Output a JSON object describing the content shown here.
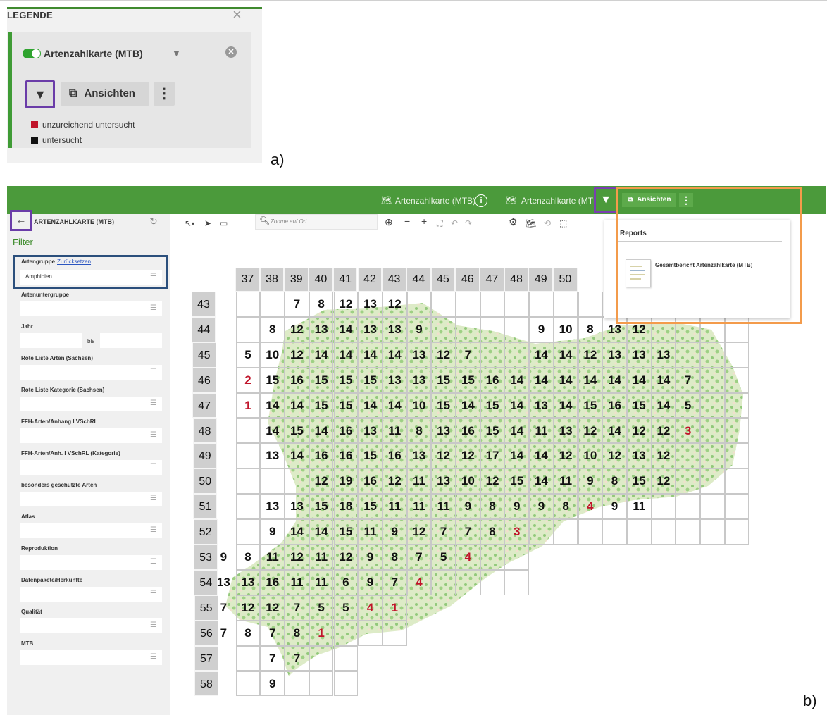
{
  "panel_a": {
    "legend_title": "LEGENDE",
    "close_glyph": "×",
    "layer_name": "Artenzahlkarte (MTB)",
    "filter_button_glyph": "▼",
    "ansichten_label": "Ansichten",
    "more_glyph": "⋮",
    "legend_items": [
      {
        "label": "unzureichend untersucht",
        "color": "#c0142a"
      },
      {
        "label": "untersucht",
        "color": "#111111"
      }
    ],
    "panel_label": "a)"
  },
  "topbar": {
    "layer_title_1": "Artenzahlkarte (MTB)",
    "layer_title_2": "Artenzahlkarte (MTE",
    "info_glyph": "i",
    "ansichten_label": "Ansichten",
    "more_glyph": "⋮"
  },
  "sidebar": {
    "title": "ARTENZAHLKARTE (MTB)",
    "filter_heading": "Filter",
    "artengruppe": {
      "label": "Artengruppe",
      "reset_link": "Zurücksetzen",
      "value": "Amphibien"
    },
    "fields": [
      {
        "label": "Artenuntergruppe"
      },
      {
        "label": "Jahr",
        "between": "bis"
      },
      {
        "label": "Rote Liste Arten (Sachsen)"
      },
      {
        "label": "Rote Liste Kategorie (Sachsen)"
      },
      {
        "label": "FFH-Arten/Anhang I VSchRL"
      },
      {
        "label": "FFH-Arten/Anh. I VSchRL (Kategorie)"
      },
      {
        "label": "besonders geschützte Arten"
      },
      {
        "label": "Atlas"
      },
      {
        "label": "Reproduktion"
      },
      {
        "label": "Datenpakete/Herkünfte"
      },
      {
        "label": "Qualität"
      },
      {
        "label": "MTB"
      }
    ]
  },
  "map_toolbar": {
    "search_placeholder": "Zoome auf Ort ..."
  },
  "reports": {
    "title": "Reports",
    "item": "Gesamtbericht Artenzahlkarte (MTB)"
  },
  "map": {
    "column_headers": [
      "37",
      "38",
      "39",
      "40",
      "41",
      "42",
      "43",
      "44",
      "45",
      "46",
      "47",
      "48",
      "49",
      "50"
    ],
    "row_headers": [
      "43",
      "44",
      "45",
      "46",
      "47",
      "48",
      "49",
      "50",
      "51",
      "52",
      "53",
      "54",
      "55",
      "56",
      "57",
      "58"
    ],
    "red_color": "#c0142a",
    "black_color": "#111111",
    "counts": [
      {
        "row": 0,
        "col": 3,
        "v": "7"
      },
      {
        "row": 0,
        "col": 4,
        "v": "8"
      },
      {
        "row": 0,
        "col": 5,
        "v": "12"
      },
      {
        "row": 0,
        "col": 6,
        "v": "13"
      },
      {
        "row": 0,
        "col": 7,
        "v": "12"
      },
      {
        "row": 1,
        "col": 2,
        "v": "8"
      },
      {
        "row": 1,
        "col": 3,
        "v": "12"
      },
      {
        "row": 1,
        "col": 4,
        "v": "13"
      },
      {
        "row": 1,
        "col": 5,
        "v": "14"
      },
      {
        "row": 1,
        "col": 6,
        "v": "13"
      },
      {
        "row": 1,
        "col": 7,
        "v": "13"
      },
      {
        "row": 1,
        "col": 8,
        "v": "9"
      },
      {
        "row": 1,
        "col": 13,
        "v": "9"
      },
      {
        "row": 1,
        "col": 14,
        "v": "10"
      },
      {
        "row": 1,
        "col": 15,
        "v": "8"
      },
      {
        "row": 1,
        "col": 16,
        "v": "13"
      },
      {
        "row": 1,
        "col": 17,
        "v": "12"
      },
      {
        "row": 2,
        "col": 1,
        "v": "5"
      },
      {
        "row": 2,
        "col": 2,
        "v": "10"
      },
      {
        "row": 2,
        "col": 3,
        "v": "12"
      },
      {
        "row": 2,
        "col": 4,
        "v": "14"
      },
      {
        "row": 2,
        "col": 5,
        "v": "14"
      },
      {
        "row": 2,
        "col": 6,
        "v": "14"
      },
      {
        "row": 2,
        "col": 7,
        "v": "14"
      },
      {
        "row": 2,
        "col": 8,
        "v": "13"
      },
      {
        "row": 2,
        "col": 9,
        "v": "12"
      },
      {
        "row": 2,
        "col": 10,
        "v": "7"
      },
      {
        "row": 2,
        "col": 13,
        "v": "14"
      },
      {
        "row": 2,
        "col": 14,
        "v": "14"
      },
      {
        "row": 2,
        "col": 15,
        "v": "12"
      },
      {
        "row": 2,
        "col": 16,
        "v": "13"
      },
      {
        "row": 2,
        "col": 17,
        "v": "13"
      },
      {
        "row": 2,
        "col": 18,
        "v": "13"
      },
      {
        "row": 3,
        "col": 1,
        "v": "2",
        "red": true
      },
      {
        "row": 3,
        "col": 2,
        "v": "15"
      },
      {
        "row": 3,
        "col": 3,
        "v": "16"
      },
      {
        "row": 3,
        "col": 4,
        "v": "15"
      },
      {
        "row": 3,
        "col": 5,
        "v": "15"
      },
      {
        "row": 3,
        "col": 6,
        "v": "15"
      },
      {
        "row": 3,
        "col": 7,
        "v": "13"
      },
      {
        "row": 3,
        "col": 8,
        "v": "13"
      },
      {
        "row": 3,
        "col": 9,
        "v": "15"
      },
      {
        "row": 3,
        "col": 10,
        "v": "15"
      },
      {
        "row": 3,
        "col": 11,
        "v": "16"
      },
      {
        "row": 3,
        "col": 12,
        "v": "14"
      },
      {
        "row": 3,
        "col": 13,
        "v": "14"
      },
      {
        "row": 3,
        "col": 14,
        "v": "14"
      },
      {
        "row": 3,
        "col": 15,
        "v": "14"
      },
      {
        "row": 3,
        "col": 16,
        "v": "14"
      },
      {
        "row": 3,
        "col": 17,
        "v": "14"
      },
      {
        "row": 3,
        "col": 18,
        "v": "14"
      },
      {
        "row": 3,
        "col": 19,
        "v": "7"
      },
      {
        "row": 4,
        "col": 1,
        "v": "1",
        "red": true
      },
      {
        "row": 4,
        "col": 2,
        "v": "14"
      },
      {
        "row": 4,
        "col": 3,
        "v": "14"
      },
      {
        "row": 4,
        "col": 4,
        "v": "15"
      },
      {
        "row": 4,
        "col": 5,
        "v": "15"
      },
      {
        "row": 4,
        "col": 6,
        "v": "14"
      },
      {
        "row": 4,
        "col": 7,
        "v": "14"
      },
      {
        "row": 4,
        "col": 8,
        "v": "10"
      },
      {
        "row": 4,
        "col": 9,
        "v": "15"
      },
      {
        "row": 4,
        "col": 10,
        "v": "14"
      },
      {
        "row": 4,
        "col": 11,
        "v": "15"
      },
      {
        "row": 4,
        "col": 12,
        "v": "14"
      },
      {
        "row": 4,
        "col": 13,
        "v": "13"
      },
      {
        "row": 4,
        "col": 14,
        "v": "14"
      },
      {
        "row": 4,
        "col": 15,
        "v": "15"
      },
      {
        "row": 4,
        "col": 16,
        "v": "16"
      },
      {
        "row": 4,
        "col": 17,
        "v": "15"
      },
      {
        "row": 4,
        "col": 18,
        "v": "14"
      },
      {
        "row": 4,
        "col": 19,
        "v": "5"
      },
      {
        "row": 5,
        "col": 2,
        "v": "14"
      },
      {
        "row": 5,
        "col": 3,
        "v": "15"
      },
      {
        "row": 5,
        "col": 4,
        "v": "14"
      },
      {
        "row": 5,
        "col": 5,
        "v": "16"
      },
      {
        "row": 5,
        "col": 6,
        "v": "13"
      },
      {
        "row": 5,
        "col": 7,
        "v": "11"
      },
      {
        "row": 5,
        "col": 8,
        "v": "8"
      },
      {
        "row": 5,
        "col": 9,
        "v": "13"
      },
      {
        "row": 5,
        "col": 10,
        "v": "16"
      },
      {
        "row": 5,
        "col": 11,
        "v": "15"
      },
      {
        "row": 5,
        "col": 12,
        "v": "14"
      },
      {
        "row": 5,
        "col": 13,
        "v": "11"
      },
      {
        "row": 5,
        "col": 14,
        "v": "13"
      },
      {
        "row": 5,
        "col": 15,
        "v": "12"
      },
      {
        "row": 5,
        "col": 16,
        "v": "14"
      },
      {
        "row": 5,
        "col": 17,
        "v": "12"
      },
      {
        "row": 5,
        "col": 18,
        "v": "12"
      },
      {
        "row": 5,
        "col": 19,
        "v": "3",
        "red": true
      },
      {
        "row": 6,
        "col": 2,
        "v": "13"
      },
      {
        "row": 6,
        "col": 3,
        "v": "14"
      },
      {
        "row": 6,
        "col": 4,
        "v": "16"
      },
      {
        "row": 6,
        "col": 5,
        "v": "16"
      },
      {
        "row": 6,
        "col": 6,
        "v": "15"
      },
      {
        "row": 6,
        "col": 7,
        "v": "16"
      },
      {
        "row": 6,
        "col": 8,
        "v": "13"
      },
      {
        "row": 6,
        "col": 9,
        "v": "12"
      },
      {
        "row": 6,
        "col": 10,
        "v": "12"
      },
      {
        "row": 6,
        "col": 11,
        "v": "17"
      },
      {
        "row": 6,
        "col": 12,
        "v": "14"
      },
      {
        "row": 6,
        "col": 13,
        "v": "14"
      },
      {
        "row": 6,
        "col": 14,
        "v": "12"
      },
      {
        "row": 6,
        "col": 15,
        "v": "10"
      },
      {
        "row": 6,
        "col": 16,
        "v": "12"
      },
      {
        "row": 6,
        "col": 17,
        "v": "13"
      },
      {
        "row": 6,
        "col": 18,
        "v": "12"
      },
      {
        "row": 7,
        "col": 4,
        "v": "12"
      },
      {
        "row": 7,
        "col": 5,
        "v": "19"
      },
      {
        "row": 7,
        "col": 6,
        "v": "16"
      },
      {
        "row": 7,
        "col": 7,
        "v": "12"
      },
      {
        "row": 7,
        "col": 8,
        "v": "11"
      },
      {
        "row": 7,
        "col": 9,
        "v": "13"
      },
      {
        "row": 7,
        "col": 10,
        "v": "10"
      },
      {
        "row": 7,
        "col": 11,
        "v": "12"
      },
      {
        "row": 7,
        "col": 12,
        "v": "15"
      },
      {
        "row": 7,
        "col": 13,
        "v": "14"
      },
      {
        "row": 7,
        "col": 14,
        "v": "11"
      },
      {
        "row": 7,
        "col": 15,
        "v": "9"
      },
      {
        "row": 7,
        "col": 16,
        "v": "8"
      },
      {
        "row": 7,
        "col": 17,
        "v": "15"
      },
      {
        "row": 7,
        "col": 18,
        "v": "12"
      },
      {
        "row": 8,
        "col": 2,
        "v": "13"
      },
      {
        "row": 8,
        "col": 3,
        "v": "13"
      },
      {
        "row": 8,
        "col": 4,
        "v": "15"
      },
      {
        "row": 8,
        "col": 5,
        "v": "18"
      },
      {
        "row": 8,
        "col": 6,
        "v": "15"
      },
      {
        "row": 8,
        "col": 7,
        "v": "11"
      },
      {
        "row": 8,
        "col": 8,
        "v": "11"
      },
      {
        "row": 8,
        "col": 9,
        "v": "11"
      },
      {
        "row": 8,
        "col": 10,
        "v": "9"
      },
      {
        "row": 8,
        "col": 11,
        "v": "8"
      },
      {
        "row": 8,
        "col": 12,
        "v": "9"
      },
      {
        "row": 8,
        "col": 13,
        "v": "9"
      },
      {
        "row": 8,
        "col": 14,
        "v": "8"
      },
      {
        "row": 8,
        "col": 15,
        "v": "4",
        "red": true
      },
      {
        "row": 8,
        "col": 16,
        "v": "9"
      },
      {
        "row": 8,
        "col": 17,
        "v": "11"
      },
      {
        "row": 9,
        "col": 2,
        "v": "9"
      },
      {
        "row": 9,
        "col": 3,
        "v": "14"
      },
      {
        "row": 9,
        "col": 4,
        "v": "14"
      },
      {
        "row": 9,
        "col": 5,
        "v": "15"
      },
      {
        "row": 9,
        "col": 6,
        "v": "11"
      },
      {
        "row": 9,
        "col": 7,
        "v": "9"
      },
      {
        "row": 9,
        "col": 8,
        "v": "12"
      },
      {
        "row": 9,
        "col": 9,
        "v": "7"
      },
      {
        "row": 9,
        "col": 10,
        "v": "7"
      },
      {
        "row": 9,
        "col": 11,
        "v": "8"
      },
      {
        "row": 9,
        "col": 12,
        "v": "3",
        "red": true
      },
      {
        "row": 10,
        "col": 0,
        "v": "9"
      },
      {
        "row": 10,
        "col": 1,
        "v": "8"
      },
      {
        "row": 10,
        "col": 2,
        "v": "11"
      },
      {
        "row": 10,
        "col": 3,
        "v": "12"
      },
      {
        "row": 10,
        "col": 4,
        "v": "11"
      },
      {
        "row": 10,
        "col": 5,
        "v": "12"
      },
      {
        "row": 10,
        "col": 6,
        "v": "9"
      },
      {
        "row": 10,
        "col": 7,
        "v": "8"
      },
      {
        "row": 10,
        "col": 8,
        "v": "7"
      },
      {
        "row": 10,
        "col": 9,
        "v": "5"
      },
      {
        "row": 10,
        "col": 10,
        "v": "4",
        "red": true
      },
      {
        "row": 11,
        "col": 0,
        "v": "13"
      },
      {
        "row": 11,
        "col": 1,
        "v": "13"
      },
      {
        "row": 11,
        "col": 2,
        "v": "16"
      },
      {
        "row": 11,
        "col": 3,
        "v": "11"
      },
      {
        "row": 11,
        "col": 4,
        "v": "11"
      },
      {
        "row": 11,
        "col": 5,
        "v": "6"
      },
      {
        "row": 11,
        "col": 6,
        "v": "9"
      },
      {
        "row": 11,
        "col": 7,
        "v": "7"
      },
      {
        "row": 11,
        "col": 8,
        "v": "4",
        "red": true
      },
      {
        "row": 12,
        "col": 0,
        "v": "7"
      },
      {
        "row": 12,
        "col": 1,
        "v": "12"
      },
      {
        "row": 12,
        "col": 2,
        "v": "12"
      },
      {
        "row": 12,
        "col": 3,
        "v": "7"
      },
      {
        "row": 12,
        "col": 4,
        "v": "5"
      },
      {
        "row": 12,
        "col": 5,
        "v": "5"
      },
      {
        "row": 12,
        "col": 6,
        "v": "4",
        "red": true
      },
      {
        "row": 12,
        "col": 7,
        "v": "1",
        "red": true
      },
      {
        "row": 13,
        "col": 0,
        "v": "7"
      },
      {
        "row": 13,
        "col": 1,
        "v": "8"
      },
      {
        "row": 13,
        "col": 2,
        "v": "7"
      },
      {
        "row": 13,
        "col": 3,
        "v": "8"
      },
      {
        "row": 13,
        "col": 4,
        "v": "1",
        "red": true
      },
      {
        "row": 14,
        "col": 2,
        "v": "7"
      },
      {
        "row": 14,
        "col": 3,
        "v": "7"
      },
      {
        "row": 15,
        "col": 2,
        "v": "9"
      }
    ]
  },
  "panel_label_b": "b)"
}
